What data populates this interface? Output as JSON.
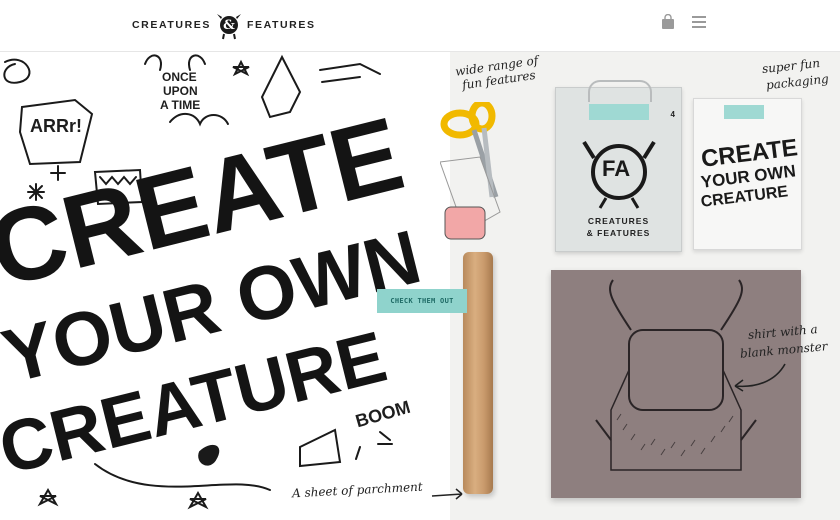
{
  "header": {
    "logo_left": "CREATURES",
    "logo_right": "FEATURES",
    "logo_amp": "&"
  },
  "icons": {
    "bag": "shopping-bag-icon",
    "menu": "hamburger-menu-icon"
  },
  "hero": {
    "headline_line1": "CREATE",
    "headline_line2": "YOUR OWN",
    "headline_line3": "CREATURE",
    "doodle_arrr": "ARRr!",
    "doodle_once": "ONCE",
    "doodle_upon": "UPON",
    "doodle_atime": "A TIME",
    "doodle_boom": "BOOM",
    "cta_label": "CHECK THEM OUT",
    "note_features_1": "wide range of",
    "note_features_2": "fun features",
    "note_packaging_1": "super fun",
    "note_packaging_2": "packaging",
    "note_shirt_1": "shirt with a",
    "note_shirt_2": "blank monster",
    "note_parchment": "A sheet of parchment",
    "package_title_1": "CREATURES",
    "package_title_2": "& FEATURES",
    "package_badge": "4",
    "package_fa": "FA",
    "poster_line1": "CREATE",
    "poster_line2": "YOUR OWN",
    "poster_line3": "CREATURE"
  },
  "colors": {
    "cta_bg": "#8fd3cc",
    "shirt": "#8e7f7f",
    "ink": "#141414"
  }
}
